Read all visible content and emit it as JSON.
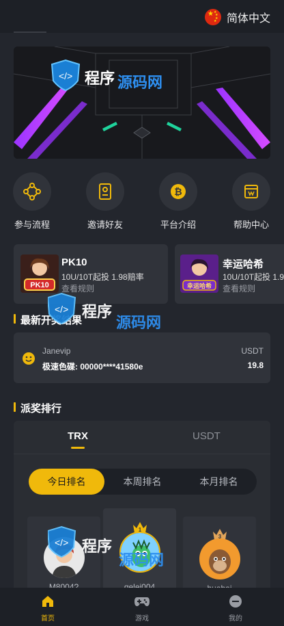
{
  "header": {
    "language_label": "简体中文",
    "flag_icon": "china-flag-icon"
  },
  "banner": {
    "watermark_text": "程序源码网"
  },
  "quick_links": [
    {
      "label": "参与流程",
      "icon": "flow-icon"
    },
    {
      "label": "邀请好友",
      "icon": "invite-icon"
    },
    {
      "label": "平台介绍",
      "icon": "bitcoin-icon"
    },
    {
      "label": "帮助中心",
      "icon": "help-icon"
    }
  ],
  "games": [
    {
      "name": "PK10",
      "desc": "10U/10T起投 1.98赔率",
      "rule": "查看规则",
      "thumb_text": "PK10"
    },
    {
      "name": "幸运哈希",
      "desc": "10U/10T起投 1.9",
      "rule": "查看规则",
      "thumb_text": "幸运哈希"
    }
  ],
  "latest_section": {
    "title": "最新开奖结果",
    "entry": {
      "user": "Janevip",
      "game": "极速色碟: 00000****41580e",
      "currency": "USDT",
      "amount": "19.8"
    }
  },
  "rank_section": {
    "title": "派奖排行",
    "tabs": [
      "TRX",
      "USDT"
    ],
    "active_tab": "TRX",
    "periods": [
      "今日排名",
      "本周排名",
      "本月排名"
    ],
    "active_period": "今日排名",
    "podium": [
      {
        "name": "M8004?",
        "rank": ""
      },
      {
        "name": "gelei004",
        "rank": "1"
      },
      {
        "name": "huabai",
        "rank": "3"
      }
    ]
  },
  "bottom_nav": [
    {
      "label": "首页",
      "icon": "home-icon",
      "active": true
    },
    {
      "label": "游戏",
      "icon": "gamepad-icon",
      "active": false
    },
    {
      "label": "我的",
      "icon": "profile-icon",
      "active": false
    }
  ],
  "colors": {
    "accent": "#f0b90b",
    "background": "#23262d",
    "card": "#30333a"
  }
}
